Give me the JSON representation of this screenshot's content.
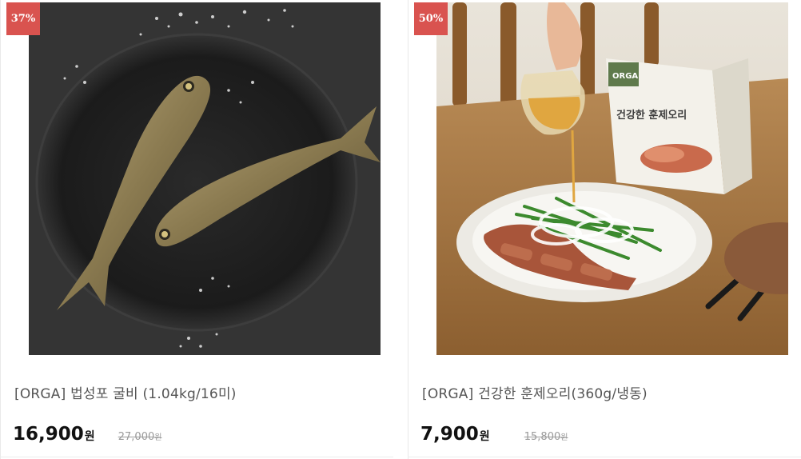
{
  "products": [
    {
      "discount": "37%",
      "image_subject": "dried yellow croaker fish on black plate with coarse salt",
      "title": "[ORGA] 법성포 굴비 (1.04kg/16미)",
      "price": "16,900",
      "price_unit": "원",
      "original_price": "27,000",
      "original_unit": "원"
    },
    {
      "discount": "50%",
      "image_subject": "sliced smoked duck with green onion salad, sauce being poured, product box behind",
      "title": "[ORGA] 건강한 훈제오리(360g/냉동)",
      "price": "7,900",
      "price_unit": "원",
      "original_price": "15,800",
      "original_unit": "원",
      "box_brand": "ORGA",
      "box_title": "건강한 훈제오리"
    }
  ],
  "colors": {
    "badge": "#d9534f",
    "title_text": "#555555",
    "price_text": "#111111",
    "original_price_text": "#9a9a9a"
  }
}
